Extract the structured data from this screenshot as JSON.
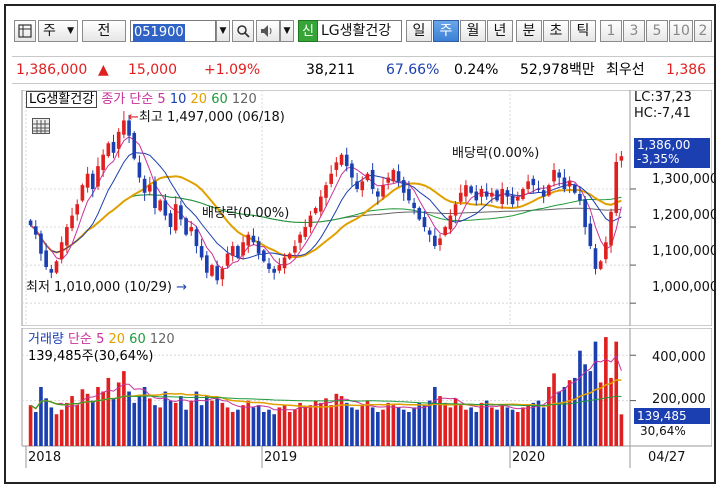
{
  "toolbar": {
    "market_type": "주",
    "period_select": "전",
    "stock_code": "051900",
    "new_badge": "신",
    "stock_name": "LG생활건강",
    "period_tabs": [
      "일",
      "주",
      "월",
      "년",
      "분",
      "초",
      "틱"
    ],
    "active_tab": "주",
    "interval_buttons": [
      "1",
      "3",
      "5",
      "10",
      "2"
    ]
  },
  "quote": {
    "price": "1,386,000",
    "change_arrow": "▲",
    "change": "15,000",
    "change_pct": "+1.09%",
    "volume": "38,211",
    "volume_ratio": "67.66%",
    "turnover_pct": "0.24%",
    "amount": "52,978백만",
    "preferred_label": "최우선",
    "preferred_value": "1,386"
  },
  "price_pane": {
    "legend_name": "LG생활건강",
    "legend_items": [
      {
        "label": "종가",
        "color": "#c8329a"
      },
      {
        "label": "단순",
        "color": "#c8329a"
      },
      {
        "label": "5",
        "color": "#c8329a"
      },
      {
        "label": "10",
        "color": "#1b3fb0"
      },
      {
        "label": "20",
        "color": "#e0a000"
      },
      {
        "label": "60",
        "color": "#1f9a3a"
      },
      {
        "label": "120",
        "color": "#666666"
      }
    ],
    "high_annotation": "최고 1,497,000 (06/18)",
    "low_annotation": "최저 1,010,000 (10/29)",
    "dividend_1": "배당락(0.00%)",
    "dividend_2": "배당락(0.00%)",
    "lc": "LC:37,23",
    "hc": "HC:-7,41",
    "current_price_box": "1,386,00",
    "current_change_box": "-3,35%",
    "y_ticks": [
      "1,300,000",
      "1,200,000",
      "1,100,000",
      "1,000,000"
    ]
  },
  "volume_pane": {
    "legend_items": [
      {
        "label": "거래량",
        "color": "#1b3fb0"
      },
      {
        "label": "단순",
        "color": "#c8329a"
      },
      {
        "label": "5",
        "color": "#c8329a"
      },
      {
        "label": "20",
        "color": "#e0a000"
      },
      {
        "label": "60",
        "color": "#1f9a3a"
      },
      {
        "label": "120",
        "color": "#666666"
      }
    ],
    "last_volume": "139,485주(30,64%)",
    "y_ticks": [
      "400,000",
      "200,000"
    ],
    "current_volume_box": "139,485",
    "current_pct_box": "30,64%"
  },
  "x_axis": {
    "labels": [
      "2018",
      "2019",
      "2020"
    ],
    "date_label": "04/27"
  },
  "colors": {
    "up": "#e02020",
    "down": "#1b3fb0",
    "ma5": "#c8329a",
    "ma10": "#1b3fb0",
    "ma20": "#e0a000",
    "ma60": "#1f9a3a",
    "ma120": "#666666"
  },
  "chart_data": {
    "type": "candlestick",
    "price_axis_range": [
      940000,
      1560000
    ],
    "volume_axis_range": [
      0,
      520000
    ],
    "closes": [
      1205000,
      1180000,
      1130000,
      1095000,
      1080000,
      1110000,
      1160000,
      1200000,
      1230000,
      1260000,
      1310000,
      1340000,
      1300000,
      1360000,
      1390000,
      1420000,
      1395000,
      1450000,
      1480000,
      1440000,
      1380000,
      1330000,
      1290000,
      1310000,
      1250000,
      1270000,
      1230000,
      1200000,
      1260000,
      1220000,
      1180000,
      1200000,
      1150000,
      1120000,
      1080000,
      1100000,
      1060000,
      1090000,
      1130000,
      1150000,
      1120000,
      1160000,
      1180000,
      1160000,
      1130000,
      1110000,
      1090000,
      1080000,
      1100000,
      1120000,
      1130000,
      1150000,
      1180000,
      1200000,
      1230000,
      1250000,
      1280000,
      1310000,
      1340000,
      1370000,
      1390000,
      1360000,
      1330000,
      1300000,
      1320000,
      1340000,
      1300000,
      1280000,
      1310000,
      1330000,
      1350000,
      1320000,
      1290000,
      1270000,
      1250000,
      1220000,
      1200000,
      1180000,
      1150000,
      1170000,
      1200000,
      1230000,
      1260000,
      1290000,
      1310000,
      1290000,
      1270000,
      1300000,
      1280000,
      1290000,
      1270000,
      1300000,
      1280000,
      1260000,
      1280000,
      1300000,
      1320000,
      1310000,
      1300000,
      1280000,
      1310000,
      1350000,
      1330000,
      1300000,
      1320000,
      1290000,
      1270000,
      1200000,
      1150000,
      1090000,
      1110000,
      1160000,
      1240000,
      1371000,
      1386000
    ],
    "volumes": [
      180000,
      150000,
      260000,
      210000,
      170000,
      140000,
      160000,
      190000,
      220000,
      180000,
      250000,
      230000,
      200000,
      260000,
      240000,
      300000,
      210000,
      280000,
      330000,
      240000,
      190000,
      220000,
      260000,
      210000,
      180000,
      170000,
      240000,
      200000,
      190000,
      220000,
      160000,
      200000,
      240000,
      180000,
      220000,
      200000,
      210000,
      190000,
      170000,
      150000,
      160000,
      180000,
      200000,
      170000,
      180000,
      150000,
      160000,
      140000,
      170000,
      180000,
      150000,
      160000,
      190000,
      170000,
      180000,
      200000,
      190000,
      210000,
      180000,
      230000,
      220000,
      190000,
      170000,
      160000,
      180000,
      200000,
      170000,
      150000,
      160000,
      190000,
      180000,
      170000,
      160000,
      150000,
      170000,
      190000,
      180000,
      200000,
      260000,
      220000,
      190000,
      170000,
      210000,
      180000,
      160000,
      170000,
      150000,
      190000,
      200000,
      170000,
      160000,
      180000,
      170000,
      160000,
      150000,
      170000,
      180000,
      190000,
      200000,
      170000,
      260000,
      320000,
      240000,
      260000,
      290000,
      300000,
      420000,
      360000,
      330000,
      460000,
      280000,
      480000,
      300000,
      460000,
      139485
    ]
  }
}
